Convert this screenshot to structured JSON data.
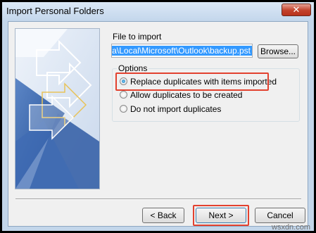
{
  "window": {
    "title": "Import Personal Folders",
    "close_label": "✕"
  },
  "file": {
    "label": "File to import",
    "path": "Data\\Local\\Microsoft\\Outlook\\backup.pst",
    "browse_label": "Browse..."
  },
  "options": {
    "label": "Options",
    "items": [
      {
        "label": "Replace duplicates with items imported",
        "selected": true
      },
      {
        "label": "Allow duplicates to be created",
        "selected": false
      },
      {
        "label": "Do not import duplicates",
        "selected": false
      }
    ]
  },
  "buttons": {
    "back_label": "< Back",
    "next_label": "Next >",
    "cancel_label": "Cancel"
  },
  "watermark": "wsxdn.com",
  "colors": {
    "highlight": "#e2412f",
    "selection": "#3399ff",
    "graphic_blue": "#2f5aa3"
  }
}
